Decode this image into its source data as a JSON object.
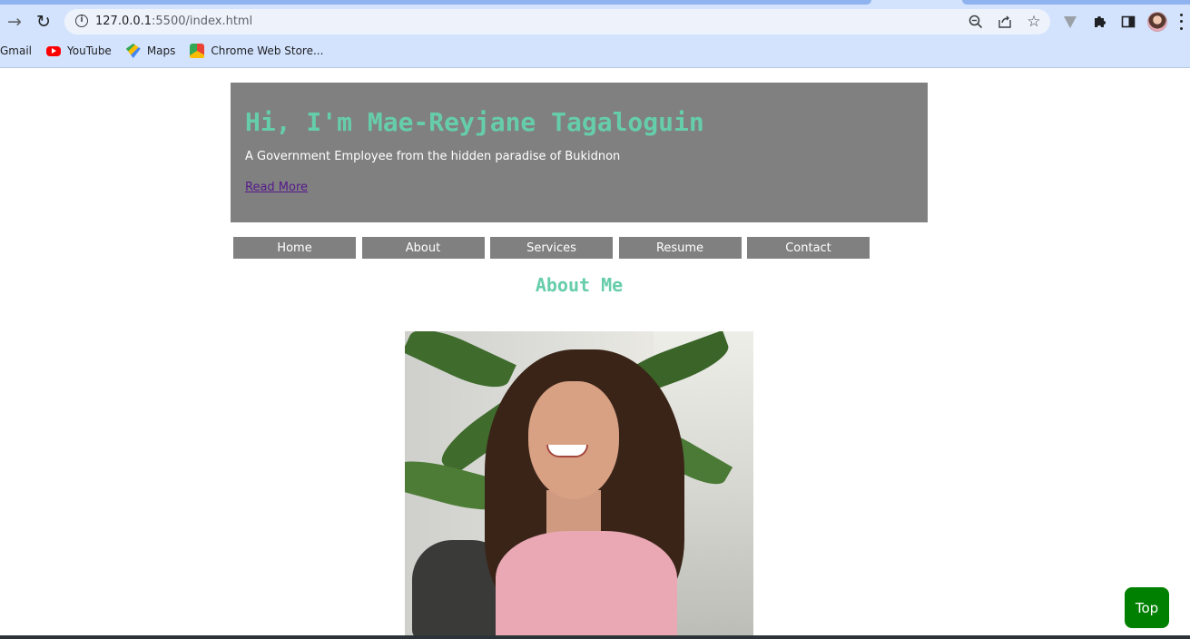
{
  "browser": {
    "url_host": "127.0.0.1",
    "url_rest": ":5500/index.html",
    "bookmarks": [
      {
        "label": "Gmail",
        "icon": "gmail-icon"
      },
      {
        "label": "YouTube",
        "icon": "youtube-icon"
      },
      {
        "label": "Maps",
        "icon": "maps-icon"
      },
      {
        "label": "Chrome Web Store...",
        "icon": "chrome-web-store-icon"
      }
    ]
  },
  "hero": {
    "title": "Hi, I'm Mae-Reyjane Tagaloguin",
    "subtitle": "A Government Employee from the hidden paradise of Bukidnon",
    "link": "Read More"
  },
  "nav": {
    "items": [
      "Home",
      "About",
      "Services",
      "Resume",
      "Contact"
    ]
  },
  "about": {
    "title": "About Me"
  },
  "top_button": "Top",
  "colors": {
    "accent": "#66cdaa",
    "panel": "#808080",
    "top_button": "#008000",
    "link_visited": "#551a8b"
  }
}
